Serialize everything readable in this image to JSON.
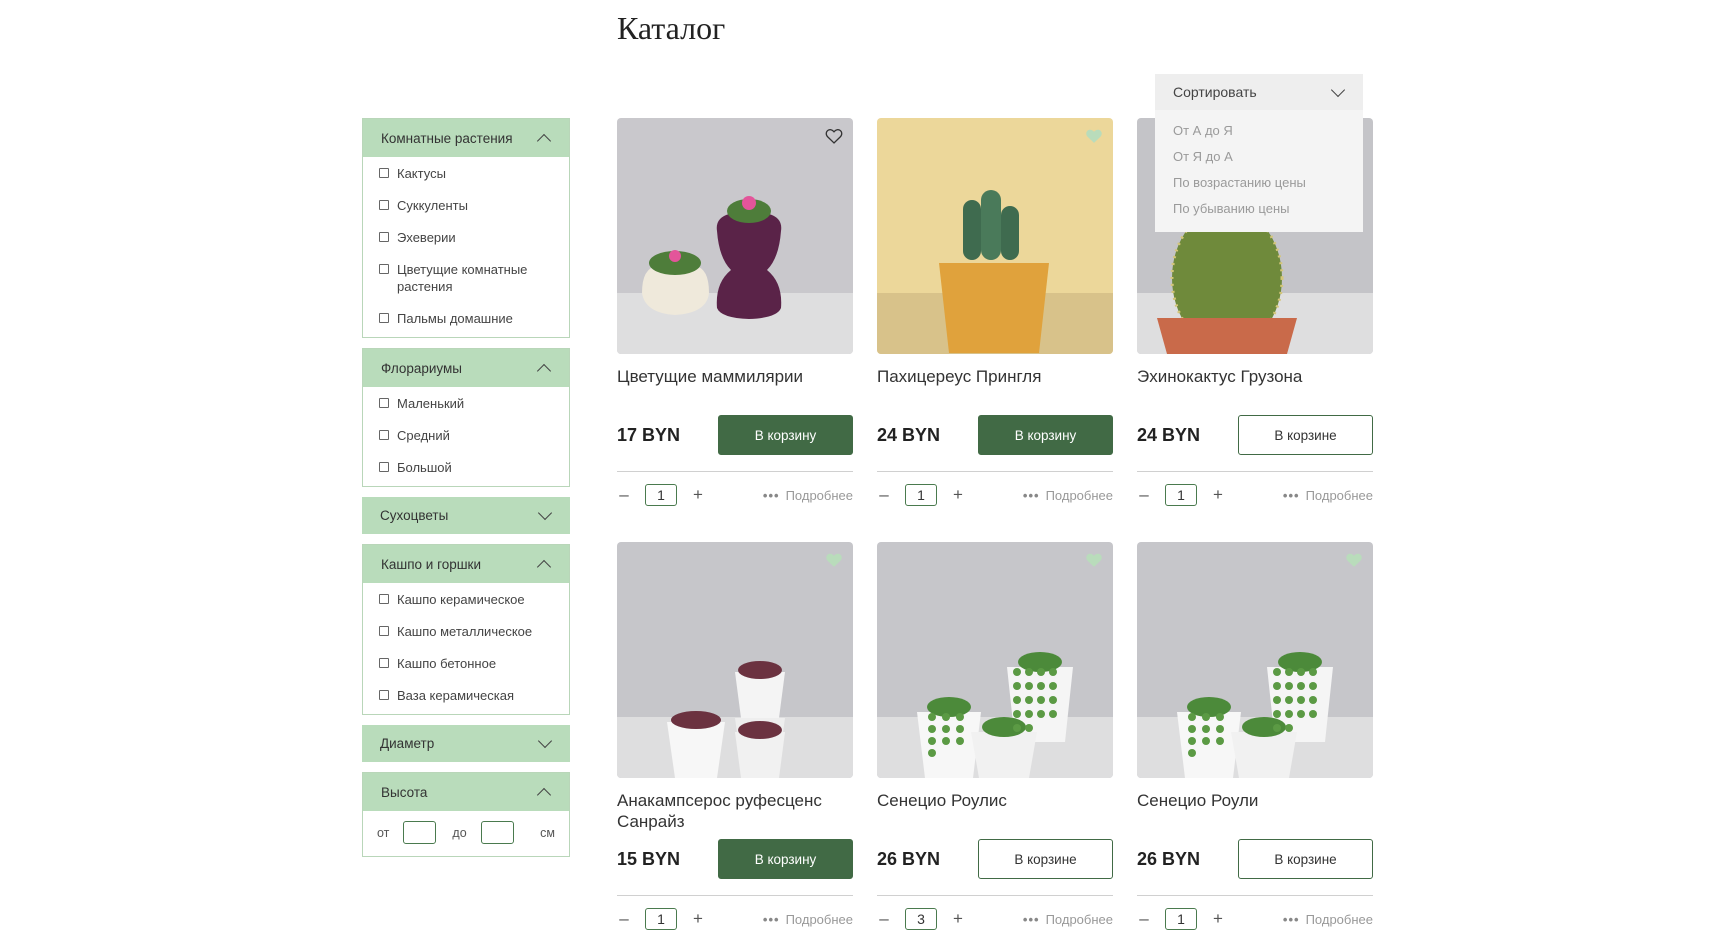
{
  "page": {
    "title": "Каталог"
  },
  "sort": {
    "label": "Сортировать",
    "options": [
      "От А до Я",
      "От Я до А",
      "По возрастанию цены",
      "По убыванию цены"
    ]
  },
  "filters": {
    "groups": [
      {
        "title": "Комнатные растения",
        "expanded": true,
        "options": [
          "Кактусы",
          "Суккуленты",
          "Эхеверии",
          "Цветущие комнатные растения",
          "Пальмы домашние"
        ]
      },
      {
        "title": "Флорариумы",
        "expanded": true,
        "options": [
          "Маленький",
          "Средний",
          "Большой"
        ]
      },
      {
        "title": "Сухоцветы",
        "expanded": false,
        "options": []
      },
      {
        "title": "Кашпо и горшки",
        "expanded": true,
        "options": [
          "Кашпо керамическое",
          "Кашпо металлическое",
          "Кашпо бетонное",
          "Ваза керамическая"
        ]
      },
      {
        "title": "Диаметр",
        "expanded": false,
        "options": []
      }
    ],
    "height": {
      "title": "Высота",
      "from_label": "от",
      "to_label": "до",
      "unit": "см",
      "from_value": "",
      "to_value": ""
    }
  },
  "products": [
    {
      "name": "Цветущие маммилярии",
      "price": "17 BYN",
      "button": "В корзину",
      "in_cart": false,
      "qty": "1",
      "more": "Подробнее",
      "favorite": false,
      "bg": "#c9c8cc"
    },
    {
      "name": "Пахицереус Прингля",
      "price": "24 BYN",
      "button": "В корзину",
      "in_cart": false,
      "qty": "1",
      "more": "Подробнее",
      "favorite": true,
      "bg": "#ecd79a"
    },
    {
      "name": "Эхинокактус Грузона",
      "price": "24 BYN",
      "button": "В корзине",
      "in_cart": true,
      "qty": "1",
      "more": "Подробнее",
      "favorite": true,
      "bg": "#c4c4c8"
    },
    {
      "name": "Анакампсерос руфесценс Санрайз",
      "price": "15 BYN",
      "button": "В корзину",
      "in_cart": false,
      "qty": "1",
      "more": "Подробнее",
      "favorite": true,
      "bg": "#c6c6ca"
    },
    {
      "name": "Сенецио Роулис",
      "price": "26 BYN",
      "button": "В корзине",
      "in_cart": true,
      "qty": "3",
      "more": "Подробнее",
      "favorite": true,
      "bg": "#c6c6ca"
    },
    {
      "name": "Сенецио Роули",
      "price": "26 BYN",
      "button": "В корзине",
      "in_cart": true,
      "qty": "1",
      "more": "Подробнее",
      "favorite": true,
      "bg": "#c6c6ca"
    }
  ],
  "colors": {
    "accent": "#416a45",
    "filter_header": "#b9dcbb",
    "favorite": "#b9dcbb"
  }
}
